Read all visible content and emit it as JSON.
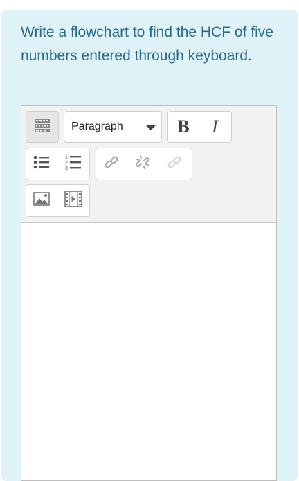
{
  "question": {
    "text": "Write a flowchart to find the HCF of five numbers entered through keyboard."
  },
  "editor": {
    "toolbar": {
      "row1": {
        "toggle_icon": "toolbar-toggle-icon",
        "format_select": {
          "selected": "Paragraph"
        },
        "bold_label": "B",
        "italic_label": "I"
      },
      "row2": {
        "icons": [
          "unordered-list-icon",
          "ordered-list-icon",
          "link-icon",
          "unlink-icon",
          "disabled-link-icon"
        ]
      },
      "row3": {
        "icons": [
          "insert-image-icon",
          "insert-media-icon"
        ]
      }
    },
    "content": ""
  }
}
